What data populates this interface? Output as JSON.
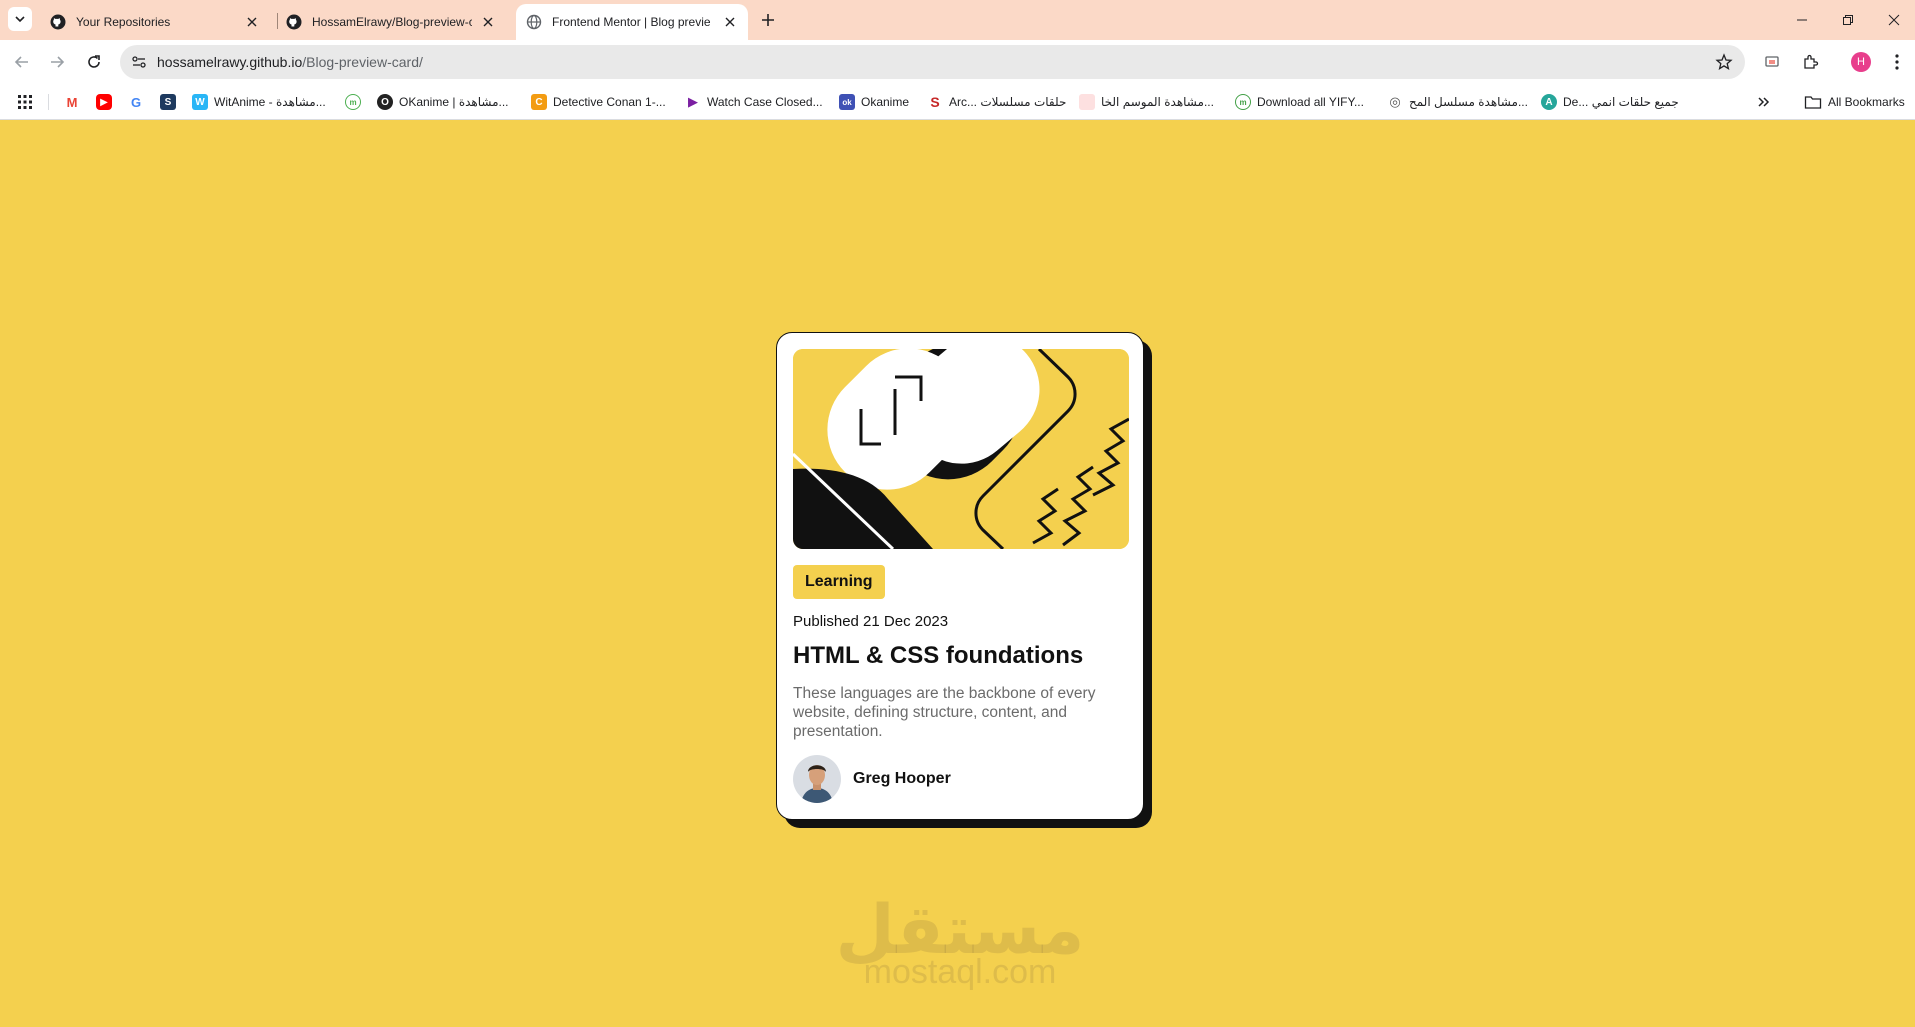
{
  "browser": {
    "tabs": [
      {
        "title": "Your Repositories",
        "icon": "github-icon",
        "active": false
      },
      {
        "title": "HossamElrawy/Blog-preview-ca",
        "icon": "github-icon",
        "active": false
      },
      {
        "title": "Frontend Mentor | Blog previe",
        "icon": "globe-icon",
        "active": true
      }
    ],
    "address_bar": {
      "domain": "hossamelrawy.github.io",
      "path": "/Blog-preview-card/"
    },
    "profile_initial": "H",
    "bookmarks": [
      {
        "label": "",
        "icon": "gmail-icon",
        "color": "#ea4335"
      },
      {
        "label": "",
        "icon": "youtube-icon",
        "color": "#ff0000"
      },
      {
        "label": "",
        "icon": "google-icon",
        "color": "#4285f4"
      },
      {
        "label": "",
        "icon": "s-icon",
        "color": "#1e3a5f"
      },
      {
        "label": "WitAnime - مشاهدة...",
        "icon": "witanime-icon",
        "color": "#29b6f6"
      },
      {
        "label": "",
        "icon": "anime-site-icon",
        "color": "#4caf50"
      },
      {
        "label": "OKanime | مشاهدة...",
        "icon": "okanime-icon",
        "color": "#222222"
      },
      {
        "label": "Detective Conan 1-...",
        "icon": "conan-icon",
        "color": "#f39c12"
      },
      {
        "label": "Watch Case Closed...",
        "icon": "play-icon",
        "color": "#7b1fa2"
      },
      {
        "label": "Okanime",
        "icon": "ok-icon",
        "color": "#3f51b5"
      },
      {
        "label": "Arc... حلقات مسلسلات",
        "icon": "arc-icon",
        "color": "#c62828"
      },
      {
        "label": "مشاهدة الموسم الخا...",
        "icon": "site-icon",
        "color": "#e57373"
      },
      {
        "label": "Download all YIFY...",
        "icon": "yify-icon",
        "color": "#43a047"
      },
      {
        "label": "مشاهدة مسلسل المح...",
        "icon": "eye-icon",
        "color": "#555555"
      },
      {
        "label": "De... جميع حلقات انمي",
        "icon": "de-icon",
        "color": "#26a69a"
      }
    ],
    "all_bookmarks_label": "All Bookmarks"
  },
  "card": {
    "category": "Learning",
    "published": "Published 21 Dec 2023",
    "title": "HTML & CSS foundations",
    "description": "These languages are the backbone of every website, defining structure, content, and presentation.",
    "author": "Greg Hooper"
  },
  "watermark": {
    "arabic": "مستقل",
    "latin": "mostaql.com"
  },
  "colors": {
    "page_background": "#f4d04e",
    "tabstrip": "#fbd9c7",
    "card_border": "#111111"
  }
}
